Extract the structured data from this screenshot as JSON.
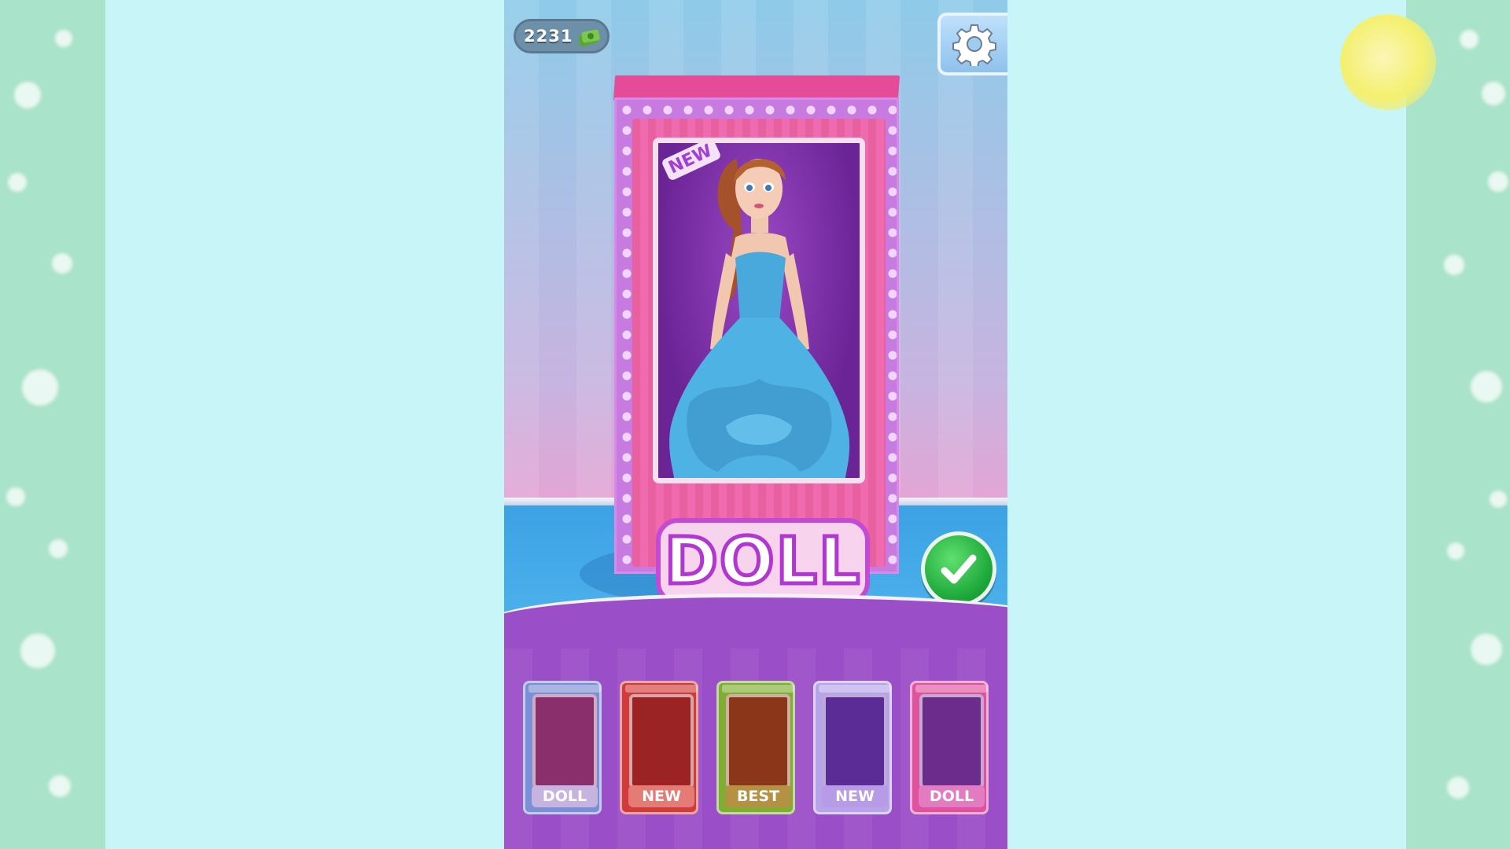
{
  "hud": {
    "coins": "2231",
    "money_icon": "money-stack-icon",
    "settings_icon": "gear-icon"
  },
  "doll_box": {
    "badge": "NEW",
    "logo": "DOLL",
    "colors": {
      "box": "#c77be0",
      "inner": "#e35b9e",
      "dress": "#49a8dc"
    }
  },
  "confirm": {
    "icon": "checkmark-icon",
    "color": "#1ea83b"
  },
  "box_options": [
    {
      "label": "DOLL",
      "frame": "#7b8fd6",
      "window": "#8a2f6c",
      "label_bg": "#c7b3e0"
    },
    {
      "label": "NEW",
      "frame": "#d23b3b",
      "window": "#9b2323",
      "label_bg": "#e47b74"
    },
    {
      "label": "BEST",
      "frame": "#7fae33",
      "window": "#8b3618",
      "label_bg": "#b59243"
    },
    {
      "label": "NEW",
      "frame": "#b6a3ea",
      "window": "#5b2b96",
      "label_bg": "#b89be6"
    },
    {
      "label": "DOLL",
      "frame": "#e0529f",
      "window": "#6c2c8c",
      "label_bg": "#e27bbf"
    }
  ]
}
